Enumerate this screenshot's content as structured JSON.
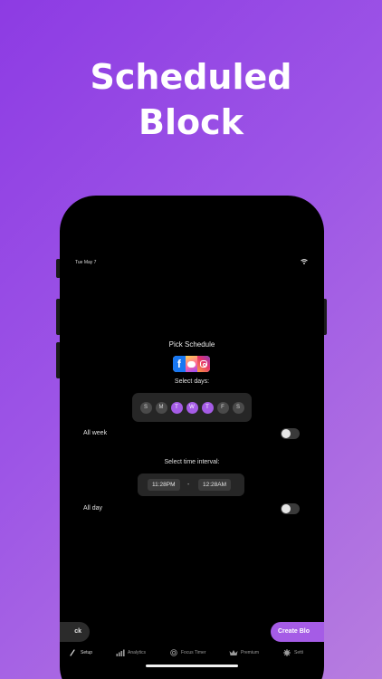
{
  "headline": {
    "line1": "Scheduled",
    "line2": "Block"
  },
  "status_bar": {
    "date": "Tue May 7"
  },
  "screen": {
    "title": "Pick Schedule",
    "days_label": "Select days:",
    "days": [
      {
        "label": "S",
        "selected": false
      },
      {
        "label": "M",
        "selected": false
      },
      {
        "label": "T",
        "selected": true
      },
      {
        "label": "W",
        "selected": true
      },
      {
        "label": "T",
        "selected": true
      },
      {
        "label": "F",
        "selected": false
      },
      {
        "label": "S",
        "selected": false
      }
    ],
    "all_week_label": "All week",
    "all_week_on": false,
    "interval_label": "Select time interval:",
    "start_time": "11:28PM",
    "separator": "-",
    "end_time": "12:28AM",
    "all_day_label": "All day",
    "all_day_on": false,
    "back_label": "ck",
    "create_label": "Create Blo"
  },
  "tabs": [
    {
      "label": "Setup",
      "icon": "setup-icon",
      "active": true
    },
    {
      "label": "Analytics",
      "icon": "bar-chart-icon",
      "active": false
    },
    {
      "label": "Focus Timer",
      "icon": "target-icon",
      "active": false
    },
    {
      "label": "Premium",
      "icon": "crown-icon",
      "active": false
    },
    {
      "label": "Setti",
      "icon": "gear-icon",
      "active": false
    }
  ],
  "colors": {
    "accent": "#a55ce6",
    "background_start": "#8d3be3",
    "background_end": "#b77ddf",
    "screen": "#000000",
    "panel": "#262626"
  }
}
